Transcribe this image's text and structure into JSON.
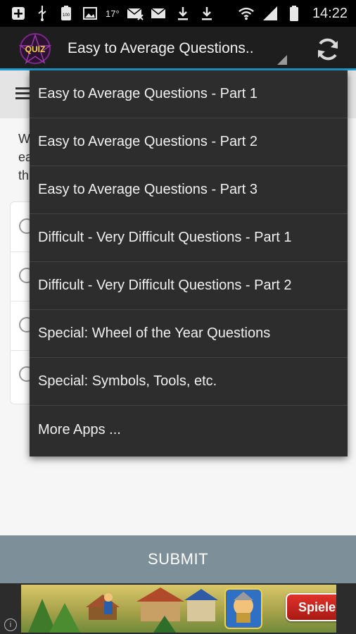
{
  "status_bar": {
    "icons": [
      "add-icon",
      "usb-icon",
      "battery-100-icon",
      "image-icon",
      "notification-17-icon",
      "mail-x-icon",
      "mail-icon",
      "download-icon",
      "download-icon",
      "wifi-icon",
      "signal-icon",
      "battery-icon"
    ],
    "battery_label": "100",
    "temp_label": "17°",
    "time": "14:22"
  },
  "action_bar": {
    "logo_text": "QUIZ",
    "spinner_selected": "Easy to Average Questions..",
    "refresh_icon": "refresh-icon",
    "accent_color": "#1f9fd1"
  },
  "dropdown": {
    "items": [
      "Easy to Average Questions - Part 1",
      "Easy to Average Questions - Part 2",
      "Easy to Average Questions - Part 3",
      "Difficult - Very Difficult Questions - Part 1",
      "Difficult - Very Difficult Questions - Part 2",
      "Special: Wheel of the Year Questions",
      "Special: Symbols, Tools, etc.",
      "More Apps ..."
    ]
  },
  "question": {
    "partial_text": "W\nea\nth"
  },
  "submit_label": "SUBMIT",
  "ad": {
    "cta_label": "Spielen",
    "info_label": "i"
  }
}
